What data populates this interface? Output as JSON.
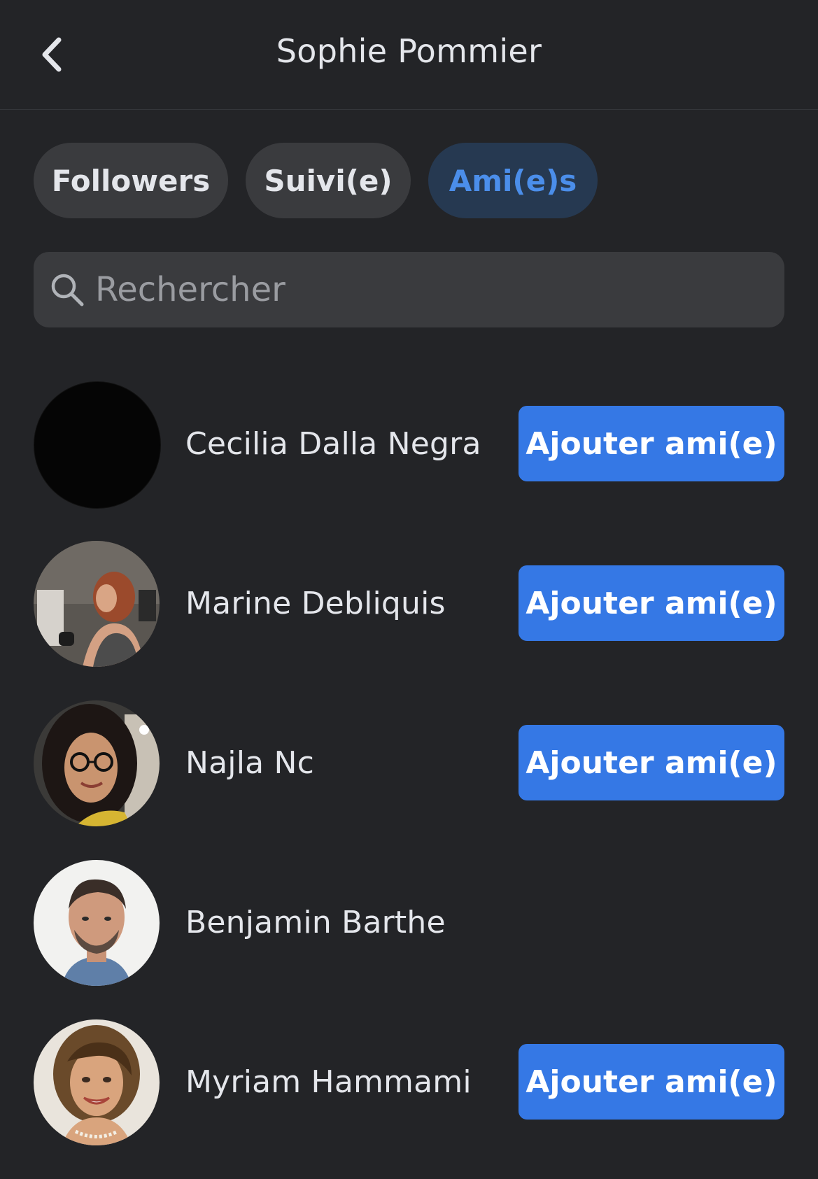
{
  "header": {
    "title": "Sophie Pommier",
    "back_icon": "chevron-left-icon"
  },
  "tabs": [
    {
      "label": "Followers",
      "active": false
    },
    {
      "label": "Suivi(e)",
      "active": false
    },
    {
      "label": "Ami(e)s",
      "active": true
    }
  ],
  "search": {
    "placeholder": "Rechercher",
    "value": "",
    "icon": "search-icon"
  },
  "colors": {
    "background": "#232427",
    "accent": "#3578e5",
    "active_tab_bg": "#263951",
    "active_tab_text": "#4b8eea",
    "chip_bg": "#3a3b3e"
  },
  "people": [
    {
      "name": "Cecilia Dalla Negra",
      "action": "Ajouter ami(e)"
    },
    {
      "name": "Marine Debliquis",
      "action": "Ajouter ami(e)"
    },
    {
      "name": "Najla Nc",
      "action": "Ajouter ami(e)"
    },
    {
      "name": "Benjamin Barthe",
      "action": null
    },
    {
      "name": "Myriam Hammami",
      "action": "Ajouter ami(e)"
    }
  ]
}
